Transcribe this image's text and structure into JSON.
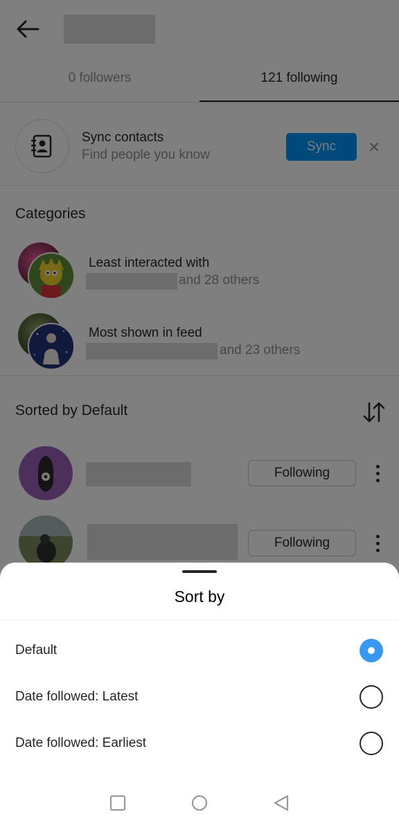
{
  "header": {
    "back_icon": "arrow-left-icon",
    "username_redacted": true
  },
  "tabs": [
    {
      "label": "0 followers",
      "active": false
    },
    {
      "label": "121 following",
      "active": true
    }
  ],
  "sync": {
    "icon": "contacts-book-icon",
    "title": "Sync contacts",
    "subtitle": "Find people you know",
    "button_label": "Sync",
    "close_icon": "close-icon",
    "button_color": "#0095f6"
  },
  "categories": {
    "title": "Categories",
    "items": [
      {
        "label": "Least interacted with",
        "others": "and 28 others"
      },
      {
        "label": "Most shown in feed",
        "others": "and 23 others"
      }
    ]
  },
  "sorted": {
    "title": "Sorted by Default",
    "sort_icon": "sort-arrows-icon"
  },
  "users": [
    {
      "button_label": "Following",
      "more_icon": "kebab-icon"
    },
    {
      "button_label": "Following",
      "more_icon": "kebab-icon"
    }
  ],
  "sheet": {
    "title": "Sort by",
    "options": [
      {
        "label": "Default",
        "selected": true
      },
      {
        "label": "Date followed: Latest",
        "selected": false
      },
      {
        "label": "Date followed: Earliest",
        "selected": false
      }
    ],
    "accent_color": "#3897f0"
  },
  "navbar": {
    "buttons": [
      "recent-apps-icon",
      "home-icon",
      "back-triangle-icon"
    ]
  }
}
